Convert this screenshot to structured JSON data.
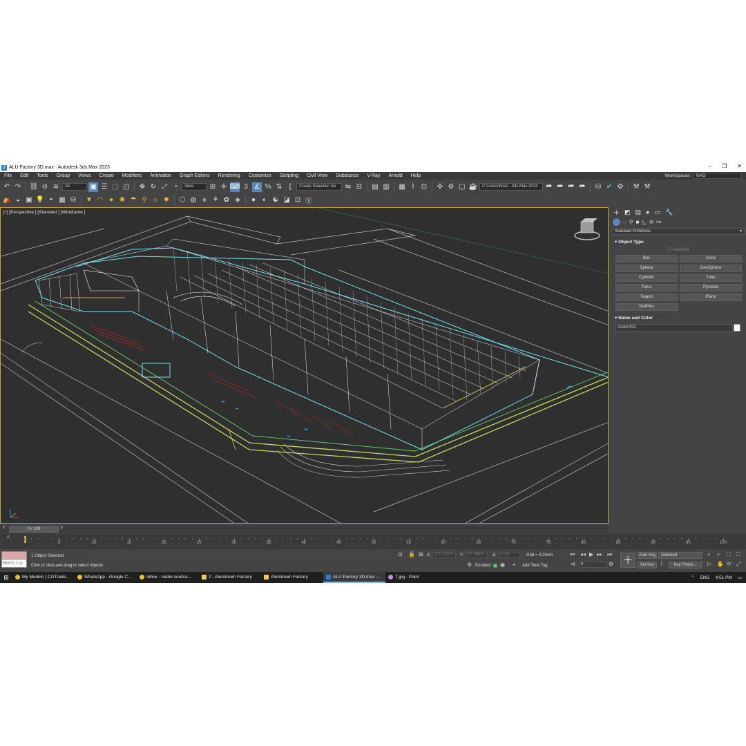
{
  "window": {
    "title": "ALU Factory 3D.max - Autodesk 3ds Max 2023",
    "controls": [
      "–",
      "❐",
      "✕"
    ]
  },
  "menu": [
    "File",
    "Edit",
    "Tools",
    "Group",
    "Views",
    "Create",
    "Modifiers",
    "Animation",
    "Graph Editors",
    "Rendering",
    "Customize",
    "Scripting",
    "Civil View",
    "Substance",
    "V-Ray",
    "Arnold",
    "Help"
  ],
  "workspaces": {
    "label": "Workspaces:",
    "value": "NAD"
  },
  "toolbar": {
    "selection_filter": "All",
    "ref_coord": "View",
    "named_selection": "Create Selection Se",
    "project_path": "C:\\Users\\NAD ..3ds Max 2023"
  },
  "viewport": {
    "label": "[+] [Perspective ] [Standard ] [Wireframe ]",
    "filter_icon": "funnel-icon"
  },
  "command_panel": {
    "category": "Standard Primitives",
    "object_type_title": "Object Type",
    "autogrid": "AutoGrid",
    "primitives": [
      "Box",
      "Cone",
      "Sphere",
      "GeoSphere",
      "Cylinder",
      "Tube",
      "Torus",
      "Pyramid",
      "Teapot",
      "Plane",
      "TextPlus"
    ],
    "name_color_title": "Name and Color",
    "object_name": "Color:001",
    "object_color": "#ffffff"
  },
  "timeline": {
    "frame_display": "0 / 100",
    "prev": "<",
    "next": ">",
    "ticks": [
      "5",
      "10",
      "15",
      "20",
      "25",
      "30",
      "35",
      "40",
      "45",
      "50",
      "55",
      "60",
      "65",
      "70",
      "75",
      "80",
      "85",
      "90",
      "95",
      "100"
    ]
  },
  "status": {
    "maxscript_label": "MAXScrip",
    "selected": "1 Object Selected",
    "prompt": "Click or click-and-drag to select objects",
    "x_label": "X:",
    "x_value": "120.202m",
    "y_label": "Y:",
    "y_value": "37.386m",
    "z_label": "Z:",
    "z_value": "0.0m",
    "grid": "Grid = 0.254m",
    "enabled": "Enabled:",
    "add_time_tag": "Add Time Tag",
    "auto_key": "Auto Key",
    "set_key": "Set Key",
    "key_mode": "Selected",
    "key_filters": "Key Filters...",
    "current_frame": "0"
  },
  "taskbar": {
    "items": [
      {
        "label": "My Models | CGTrade...",
        "color": "#e8c33a",
        "active": false
      },
      {
        "label": "WhatsApp - Google C...",
        "color": "#e8c33a",
        "active": false
      },
      {
        "label": "Inbox - nader.soubra...",
        "color": "#e8c33a",
        "active": false
      },
      {
        "label": "2 - Aluminium Factory",
        "color": "#f0c95a",
        "active": false
      },
      {
        "label": "Aluminium Factory",
        "color": "#f0c95a",
        "active": false
      },
      {
        "label": "ALU Factory 3D.max -...",
        "color": "#2a7fd4",
        "active": true
      },
      {
        "label": "7.jpg - Paint",
        "color": "#c98cd9",
        "active": false
      }
    ],
    "language": "ENG",
    "time": "4:51 PM"
  }
}
